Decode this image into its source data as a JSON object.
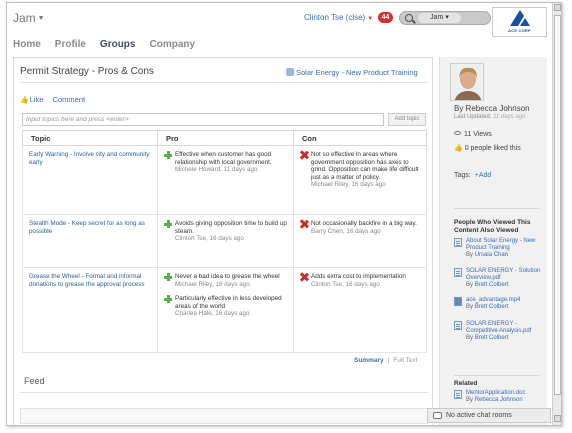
{
  "app": {
    "title": "Jam"
  },
  "header": {
    "user_label": "Clinton Tse (clse)",
    "notifications": "44",
    "search_scope": "Jam",
    "logo_text": "ACE CORP"
  },
  "nav": {
    "items": [
      "Home",
      "Profile",
      "Groups",
      "Company"
    ],
    "active": "Groups"
  },
  "page": {
    "title": "Permit Strategy - Pros & Cons",
    "related_link": "Solar Energy - New Product Training",
    "like_label": "Like",
    "comment_label": "Comment",
    "topic_placeholder": "Input topics here and press <enter>",
    "add_topic_label": "Add topic"
  },
  "table": {
    "headers": [
      "Topic",
      "Pro",
      "Con"
    ],
    "rows": [
      {
        "topic": "Early Warning - Involve city and community early",
        "pros": [
          {
            "text": "Effective when customer has good relationship with local government.",
            "meta": "Michele Howard, 11 days ago"
          }
        ],
        "cons": [
          {
            "text": "Not so effective in areas where government opposition has axes to grind. Opposition can make life difficult just as a matter of policy.",
            "meta": "Michael Riley, 16 days ago"
          }
        ]
      },
      {
        "topic": "Stealth Mode - Keep secret for as long as possible",
        "pros": [
          {
            "text": "Avoids giving opposition time to build up steam.",
            "meta": "Clinton Tse, 16 days ago"
          }
        ],
        "cons": [
          {
            "text": "Not occasionally backfire in a big way.",
            "meta": "Barry Chen, 16 days ago"
          }
        ]
      },
      {
        "topic": "Grease the Wheel - Formal and informal donations to grease the approval process",
        "pros": [
          {
            "text": "Never a bad idea to grease the wheel",
            "meta": "Michael Riley, 16 days ago"
          },
          {
            "text": "Particularly effective in less developed areas of the world",
            "meta": "Charlea Hale, 16 days ago"
          }
        ],
        "cons": [
          {
            "text": "Adds extra cost to implementation",
            "meta": "Clinton Tse, 16 days ago"
          }
        ]
      }
    ]
  },
  "view_links": {
    "summary": "Summary",
    "full_text": "Full Text",
    "separator": "|"
  },
  "feed": {
    "title": "Feed"
  },
  "sidebar": {
    "author": "By Rebecca Johnson",
    "last_updated_label": "Last Updated:",
    "last_updated_value": "11 days ago",
    "views": "11 Views",
    "likes": "0 people liked this",
    "tags_label": "Tags:",
    "add_tag": "+Add",
    "viewed_heading": "People Who Viewed This Content Also Viewed",
    "viewed_items": [
      {
        "title": "About Solar Energy - New Product Training",
        "by_label": "By",
        "by": "Ursala Chan",
        "icon": "training-icon"
      },
      {
        "title": "SOLAR ENERGY - Solution Overview.pdf",
        "by_label": "By",
        "by": "Brett Colbert",
        "icon": "document-icon"
      },
      {
        "title": "ace_advantage.mp4",
        "by_label": "By",
        "by": "Brett Colbert",
        "icon": "video-icon"
      },
      {
        "title": "SOLAR ENERGY - Competitive Analysis.pdf",
        "by_label": "By",
        "by": "Brett Colbert",
        "icon": "document-icon"
      }
    ],
    "related_heading": "Related",
    "related_items": [
      {
        "title": "MentorApplication.doc",
        "by_label": "By",
        "by": "Rebecca Johnson",
        "icon": "document-icon"
      }
    ]
  },
  "chat": {
    "label": "No active chat rooms"
  }
}
